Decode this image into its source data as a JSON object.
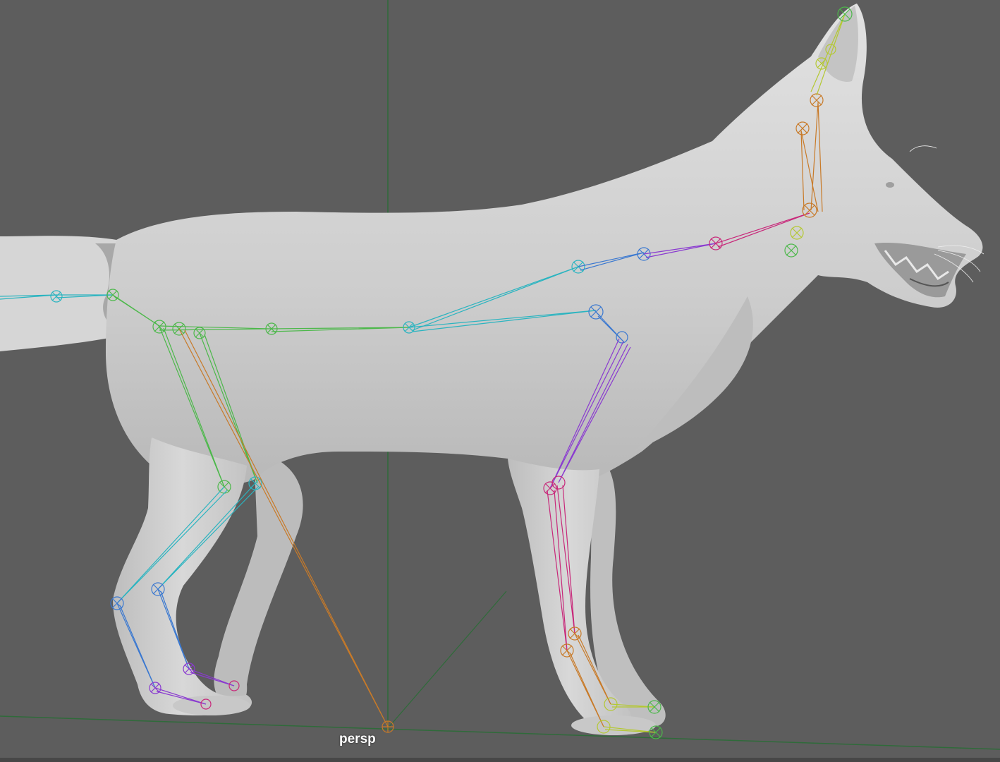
{
  "viewport": {
    "camera_label": "persp",
    "background_color": "#5d5d5d",
    "grid_axis_color": "#2f6b3a",
    "mesh_color": "#d4d4d4"
  },
  "skeleton": {
    "joint_colors": {
      "cyan": "#2ab4c0",
      "green": "#4cb84a",
      "yellow_green": "#b4c832",
      "blue": "#3a78d0",
      "purple": "#8a3ad0",
      "magenta": "#c8287a",
      "orange": "#c87a28"
    }
  }
}
